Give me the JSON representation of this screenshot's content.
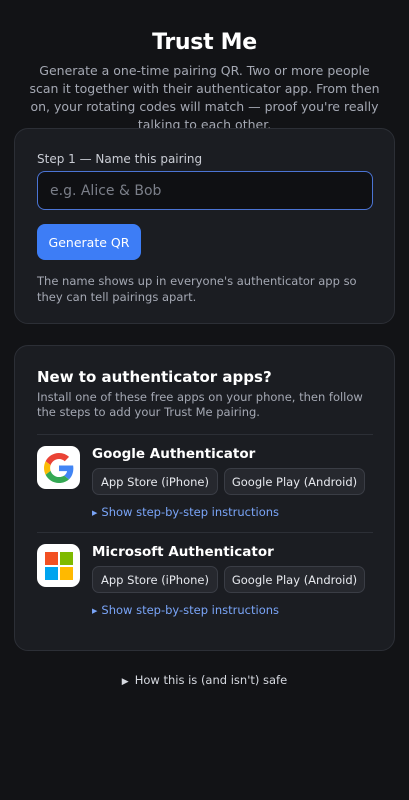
{
  "header": {
    "title": "Trust Me",
    "subtitle": "Generate a one-time pairing QR. Two or more people scan it together with their authenticator app. From then on, your rotating codes will match — proof you're really talking to each other."
  },
  "pairing_card": {
    "step_label": "Step 1 — Name this pairing",
    "name_input": {
      "value": "",
      "placeholder": "e.g. Alice & Bob"
    },
    "generate_button": "Generate QR",
    "help_text": "The name shows up in everyone's authenticator app so they can tell pairings apart."
  },
  "apps_card": {
    "title": "New to authenticator apps?",
    "description": "Install one of these free apps on your phone, then follow the steps to add your Trust Me pairing.",
    "apps": [
      {
        "name": "Google Authenticator",
        "icon": "google-authenticator-logo-icon",
        "store_ios": "App Store (iPhone)",
        "store_android": "Google Play (Android)",
        "instructions_link": "Show step-by-step instructions"
      },
      {
        "name": "Microsoft Authenticator",
        "icon": "microsoft-logo-icon",
        "store_ios": "App Store (iPhone)",
        "store_android": "Google Play (Android)",
        "instructions_link": "Show step-by-step instructions"
      }
    ]
  },
  "footer": {
    "safety_link": "How this is (and isn't) safe"
  },
  "colors": {
    "background": "#121316",
    "card": "#1b1d22",
    "accent": "#3d7df6",
    "link": "#7aa5f8"
  }
}
